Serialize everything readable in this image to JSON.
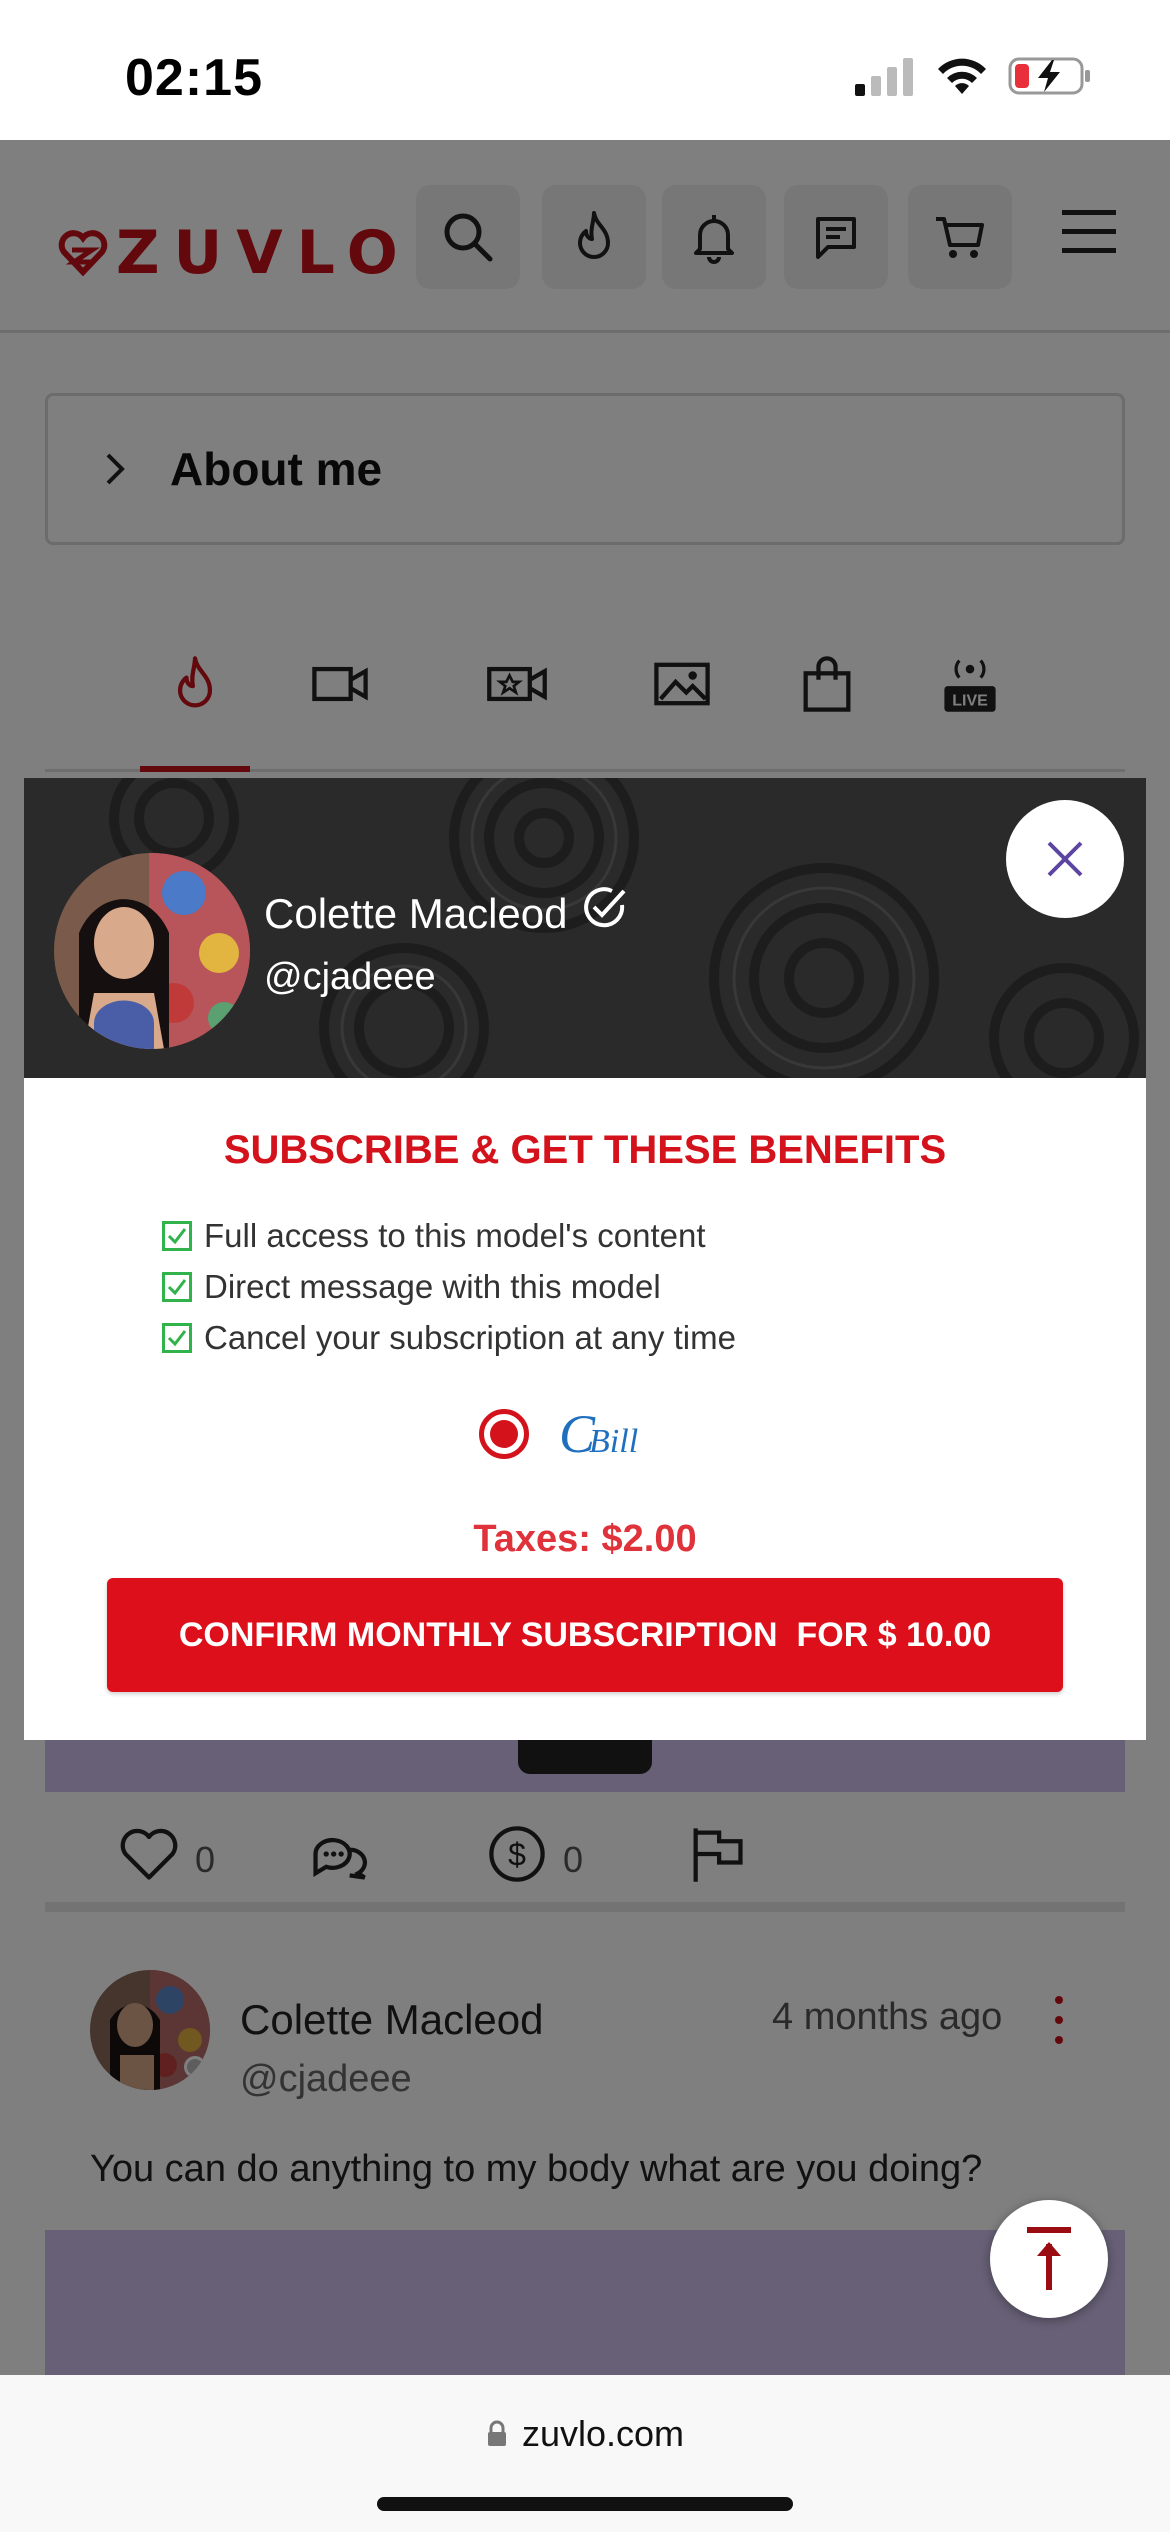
{
  "status_bar": {
    "time": "02:15"
  },
  "header": {
    "logo_text": "ZUVLO",
    "icons": [
      "search-icon",
      "flame-icon",
      "bell-icon",
      "chat-icon",
      "cart-icon",
      "menu-icon"
    ]
  },
  "about": {
    "title": "About me"
  },
  "tabs": [
    "flame-icon",
    "video-icon",
    "star-video-icon",
    "image-icon",
    "bag-icon",
    "live-icon"
  ],
  "post_actions": {
    "likes": "0",
    "tips": "0"
  },
  "post": {
    "name": "Colette Macleod",
    "handle": "@cjadeee",
    "time": "4 months ago",
    "text": "You can do anything to my body what are you doing?"
  },
  "modal": {
    "name": "Colette Macleod",
    "handle": "@cjadeee",
    "heading": "SUBSCRIBE & GET THESE BENEFITS",
    "benefits": [
      "Full access to this model's content",
      "Direct message with this model",
      "Cancel your subscription at any time"
    ],
    "payment_option": {
      "c": "C",
      "b": "Bill"
    },
    "taxes": "Taxes: $2.00",
    "confirm_label": "CONFIRM MONTHLY SUBSCRIPTION  FOR $ 10.00"
  },
  "browser": {
    "url": "zuvlo.com"
  },
  "colors": {
    "brand_red": "#c7111b",
    "accent_red": "#dc0f1a",
    "check_green": "#2fb34a",
    "purple": "#cfc0ec"
  }
}
